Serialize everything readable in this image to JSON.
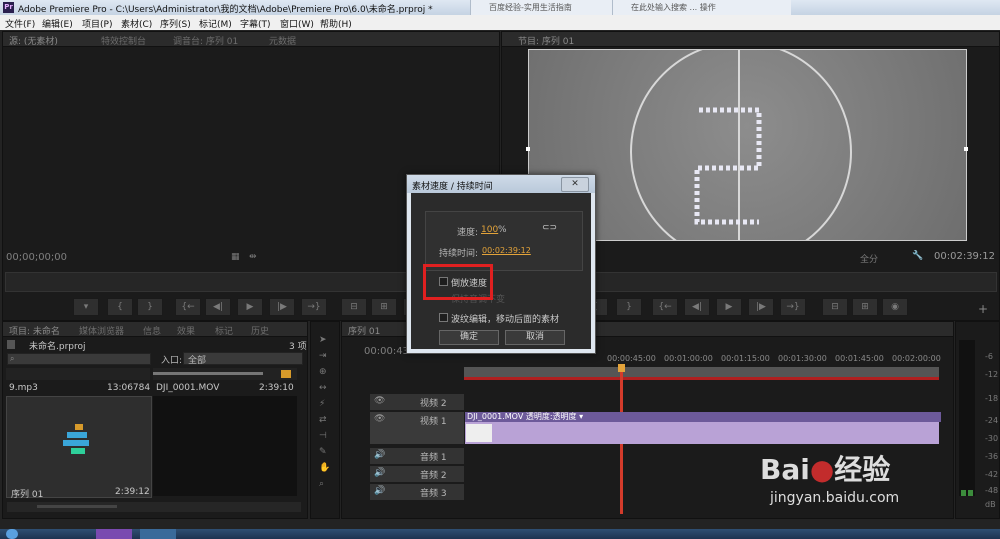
{
  "window": {
    "title": "Adobe Premiere Pro - C:\\Users\\Administrator\\我的文档\\Adobe\\Premiere Pro\\6.0\\未命名.prproj *",
    "app_icon": "Pr"
  },
  "browser_tabs": [
    "百度经验-实用生活指南",
    "在此处输入搜索 ... 操作"
  ],
  "menu": [
    "文件(F)",
    "编辑(E)",
    "项目(P)",
    "素材(C)",
    "序列(S)",
    "标记(M)",
    "字幕(T)",
    "窗口(W)",
    "帮助(H)"
  ],
  "source_panel": {
    "tabs": [
      "源: (无素材)",
      "特效控制台",
      "调音台: 序列 01",
      "元数据"
    ],
    "timecode": "00;00;00;00"
  },
  "program_panel": {
    "tab": "节目: 序列 01",
    "fit": "全分",
    "timecode": "00:02:39:12"
  },
  "project_panel": {
    "tabs": [
      "项目: 未命名",
      "媒体浏览器",
      "信息",
      "效果",
      "标记",
      "历史"
    ],
    "project_name": "未命名.prproj",
    "item_count": "3 项",
    "entry_label": "入口:",
    "entry_value": "全部",
    "items": [
      {
        "name": "9.mp3",
        "duration": "13:06784"
      },
      {
        "name": "DJI_0001.MOV",
        "duration": "2:39:10"
      },
      {
        "name": "序列 01",
        "duration": "2:39:12"
      }
    ]
  },
  "timeline": {
    "tab": "序列 01",
    "timecode": "00:00:43",
    "ruler": [
      "00:00:45:00",
      "00:01:00:00",
      "00:01:15:00",
      "00:01:30:00",
      "00:01:45:00",
      "00:02:00:00"
    ],
    "tracks": {
      "video2": "视频 2",
      "video1": "视频 1",
      "audio1": "音频 1",
      "audio2": "音频 2",
      "audio3": "音频 3"
    },
    "clip_label": "DJI_0001.MOV  透明度:透明度 ▾"
  },
  "meter": {
    "labels": [
      "-6",
      "-12",
      "-18",
      "-24",
      "-30",
      "-36",
      "-42",
      "-48",
      "dB"
    ]
  },
  "dialog": {
    "title": "素材速度 / 持续时间",
    "close": "✕",
    "speed_label": "速度:",
    "speed_value": "100",
    "speed_unit": "%",
    "duration_label": "持续时间:",
    "duration_value": "00:02:39:12",
    "reverse_label": "倒放速度",
    "keep_pitch_label": "保持音调不变",
    "ripple_label": "波纹编辑，移动后面的素材",
    "ok": "确定",
    "cancel": "取消"
  },
  "watermark": {
    "brand": "Bai",
    "brand2": "经验",
    "url": "jingyan.baidu.com"
  },
  "colors": {
    "highlight_box": "#e02020",
    "clip_purple": "#b9a2d6",
    "playhead": "#d33b2b",
    "value_orange": "#e3a33a"
  }
}
